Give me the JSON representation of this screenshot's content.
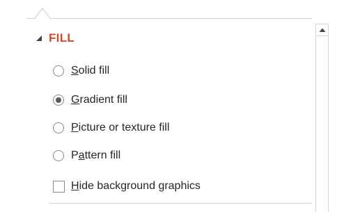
{
  "section": {
    "title": "FILL",
    "collapse_icon": "collapse-triangle-icon",
    "accent_color": "#d24726"
  },
  "fill_options": [
    {
      "prefix": "",
      "mnemonic": "S",
      "suffix": "olid fill",
      "selected": false
    },
    {
      "prefix": "",
      "mnemonic": "G",
      "suffix": "radient fill",
      "selected": true
    },
    {
      "prefix": "",
      "mnemonic": "P",
      "suffix": "icture or texture fill",
      "selected": false
    },
    {
      "prefix": "P",
      "mnemonic": "a",
      "suffix": "ttern fill",
      "selected": false
    }
  ],
  "hide_background": {
    "prefix": "",
    "mnemonic": "H",
    "suffix": "ide background graphics",
    "checked": false
  },
  "scrollbar": {
    "up_icon": "scroll-up-arrow-icon"
  }
}
